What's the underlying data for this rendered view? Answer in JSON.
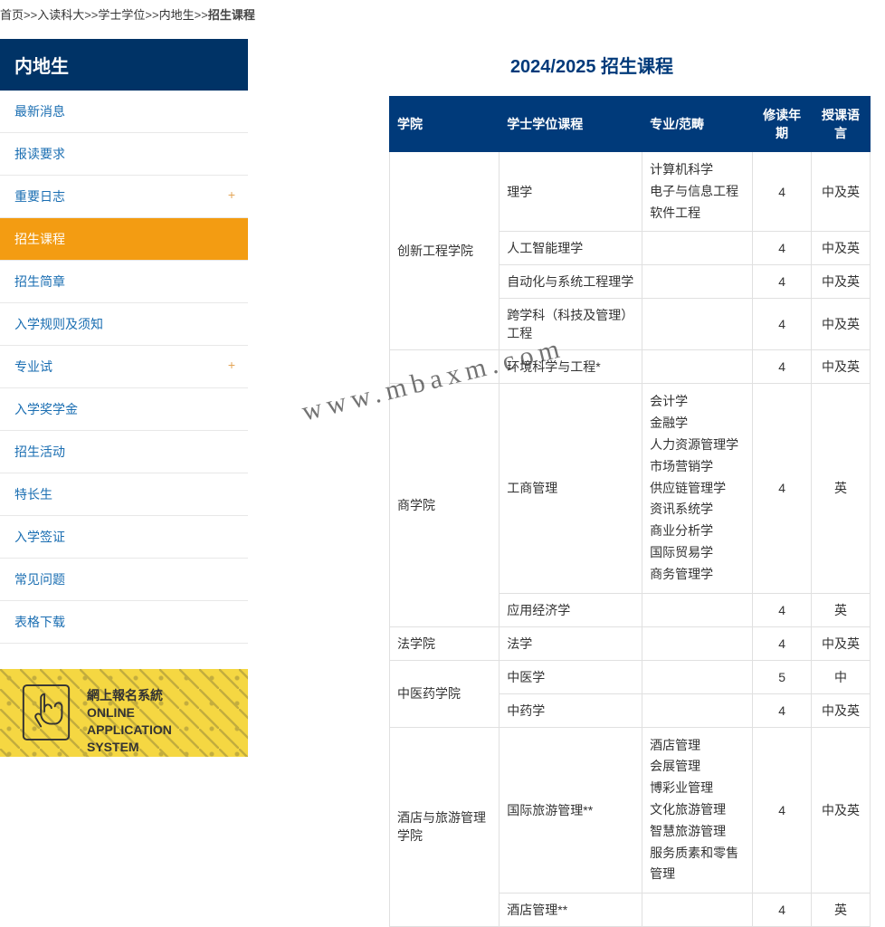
{
  "breadcrumb": {
    "sep": ">>",
    "items": [
      "首页",
      "入读科大",
      "学士学位",
      "内地生",
      "招生课程"
    ]
  },
  "sidebar": {
    "title": "内地生",
    "items": [
      {
        "label": "最新消息",
        "expandable": false
      },
      {
        "label": "报读要求",
        "expandable": false
      },
      {
        "label": "重要日志",
        "expandable": true
      },
      {
        "label": "招生课程",
        "expandable": false,
        "active": true
      },
      {
        "label": "招生简章",
        "expandable": false
      },
      {
        "label": "入学规则及须知",
        "expandable": false
      },
      {
        "label": "专业试",
        "expandable": true
      },
      {
        "label": "入学奖学金",
        "expandable": false
      },
      {
        "label": "招生活动",
        "expandable": false
      },
      {
        "label": "特长生",
        "expandable": false
      },
      {
        "label": "入学签证",
        "expandable": false
      },
      {
        "label": "常见问题",
        "expandable": false
      },
      {
        "label": "表格下载",
        "expandable": false
      }
    ]
  },
  "banner": {
    "line1": "網上報名系統",
    "line2": "ONLINE",
    "line3": "APPLICATION",
    "line4": "SYSTEM"
  },
  "page_title": "2024/2025 招生课程",
  "table": {
    "headers": {
      "faculty": "学院",
      "program": "学士学位课程",
      "major": "专业/范畴",
      "years": "修读年期",
      "lang": "授课语言"
    },
    "rows": [
      {
        "faculty": "创新工程学院",
        "faculty_rowspan": 4,
        "program": "理学",
        "majors": [
          "计算机科学",
          "电子与信息工程",
          "软件工程"
        ],
        "years": "4",
        "lang": "中及英"
      },
      {
        "program": "人工智能理学",
        "majors": [],
        "years": "4",
        "lang": "中及英"
      },
      {
        "program": "自动化与系统工程理学",
        "majors": [],
        "years": "4",
        "lang": "中及英"
      },
      {
        "program": "跨学科（科技及管理）工程",
        "majors": [],
        "years": "4",
        "lang": "中及英"
      },
      {
        "program": "环境科学与工程*",
        "majors": [],
        "years": "4",
        "lang": "中及英",
        "faculty_blank": true
      },
      {
        "faculty": "商学院",
        "faculty_rowspan": 2,
        "program": "工商管理",
        "majors": [
          "会计学",
          "金融学",
          "人力资源管理学",
          "市场营销学",
          "供应链管理学",
          "资讯系统学",
          "商业分析学",
          "国际贸易学",
          "商务管理学"
        ],
        "years": "4",
        "lang": "英"
      },
      {
        "program": "应用经济学",
        "majors": [],
        "years": "4",
        "lang": "英"
      },
      {
        "faculty": "法学院",
        "faculty_rowspan": 1,
        "program": "法学",
        "majors": [],
        "years": "4",
        "lang": "中及英"
      },
      {
        "faculty": "中医药学院",
        "faculty_rowspan": 2,
        "program": "中医学",
        "majors": [],
        "years": "5",
        "lang": "中"
      },
      {
        "program": "中药学",
        "majors": [],
        "years": "4",
        "lang": "中及英"
      },
      {
        "faculty": "酒店与旅游管理学院",
        "faculty_rowspan": 2,
        "program": "国际旅游管理**",
        "majors": [
          "酒店管理",
          "会展管理",
          "博彩业管理",
          "文化旅游管理",
          "智慧旅游管理",
          "服务质素和零售管理"
        ],
        "years": "4",
        "lang": "中及英"
      },
      {
        "program": "酒店管理**",
        "majors": [],
        "years": "4",
        "lang": "英"
      }
    ]
  },
  "watermark": "www.mbaxm.com"
}
